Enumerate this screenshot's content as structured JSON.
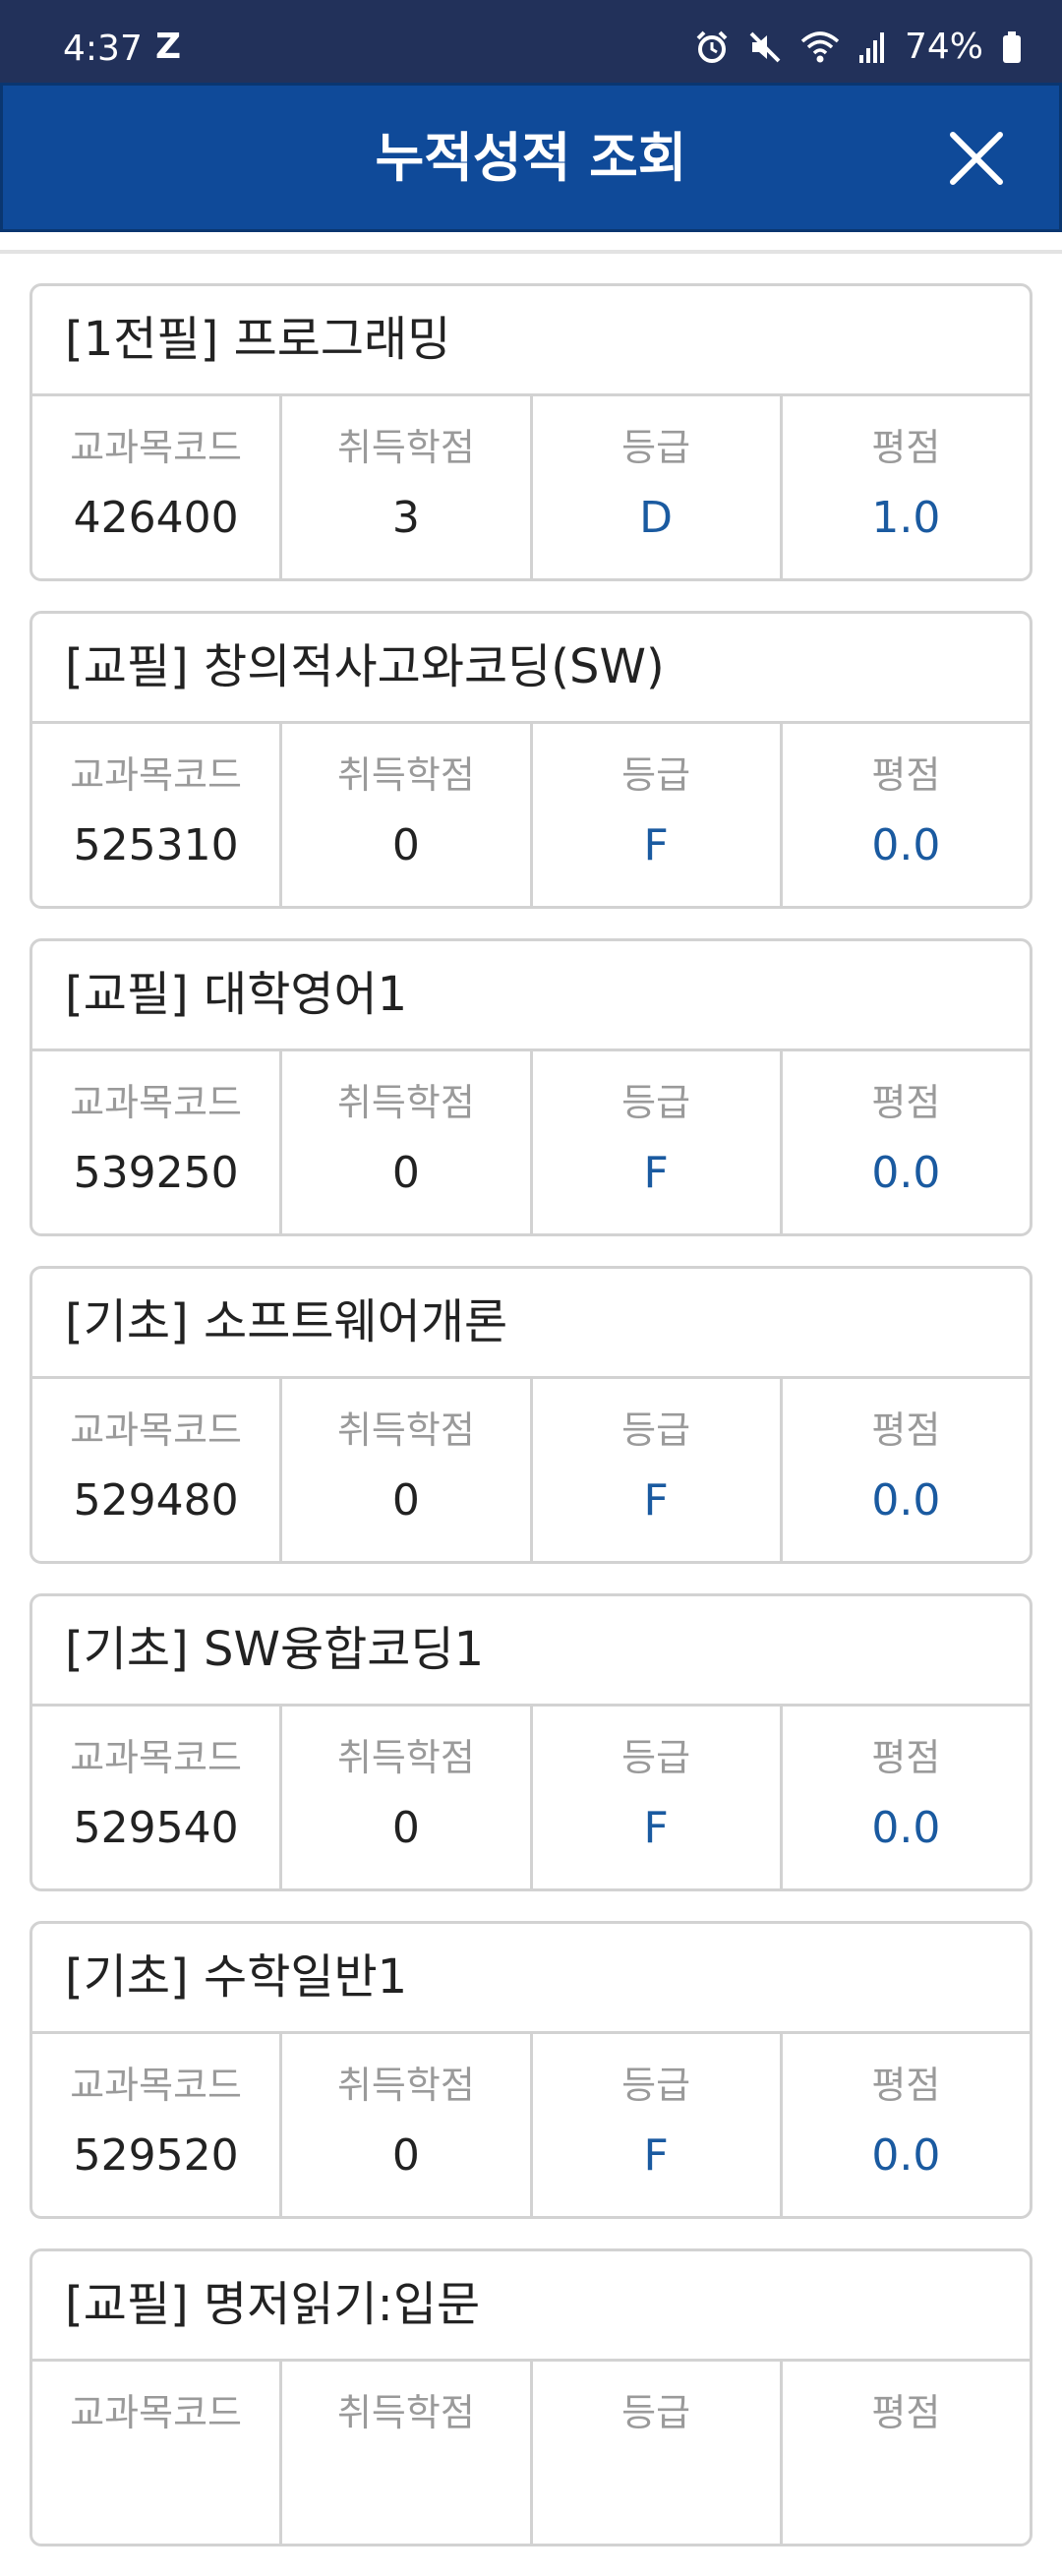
{
  "status_bar": {
    "time": "4:37",
    "z_glyph": "Z",
    "battery_percent": "74%",
    "icons": [
      "alarm-icon",
      "mute-icon",
      "wifi-icon",
      "signal-icon",
      "battery-icon"
    ]
  },
  "header": {
    "title": "누적성적 조회",
    "close_icon": "close-icon",
    "background_color": "#0f4a99"
  },
  "column_labels": {
    "code": "교과목코드",
    "credits": "취득학점",
    "grade": "등급",
    "gpa": "평점"
  },
  "courses": [
    {
      "title": "[1전필] 프로그래밍",
      "code": "426400",
      "credits": "3",
      "grade": "D",
      "gpa": "1.0"
    },
    {
      "title": "[교필] 창의적사고와코딩(SW)",
      "code": "525310",
      "credits": "0",
      "grade": "F",
      "gpa": "0.0"
    },
    {
      "title": "[교필] 대학영어1",
      "code": "539250",
      "credits": "0",
      "grade": "F",
      "gpa": "0.0"
    },
    {
      "title": "[기초] 소프트웨어개론",
      "code": "529480",
      "credits": "0",
      "grade": "F",
      "gpa": "0.0"
    },
    {
      "title": "[기초] SW융합코딩1",
      "code": "529540",
      "credits": "0",
      "grade": "F",
      "gpa": "0.0"
    },
    {
      "title": "[기초] 수학일반1",
      "code": "529520",
      "credits": "0",
      "grade": "F",
      "gpa": "0.0"
    },
    {
      "title": "[교필] 명저읽기:입문",
      "code": "",
      "credits": "",
      "grade": "",
      "gpa": ""
    }
  ],
  "colors": {
    "status_bar": "#22315a",
    "accent_blue": "#1a5aa0",
    "label_gray": "#9a9a9a",
    "border": "#d2d2d2"
  }
}
